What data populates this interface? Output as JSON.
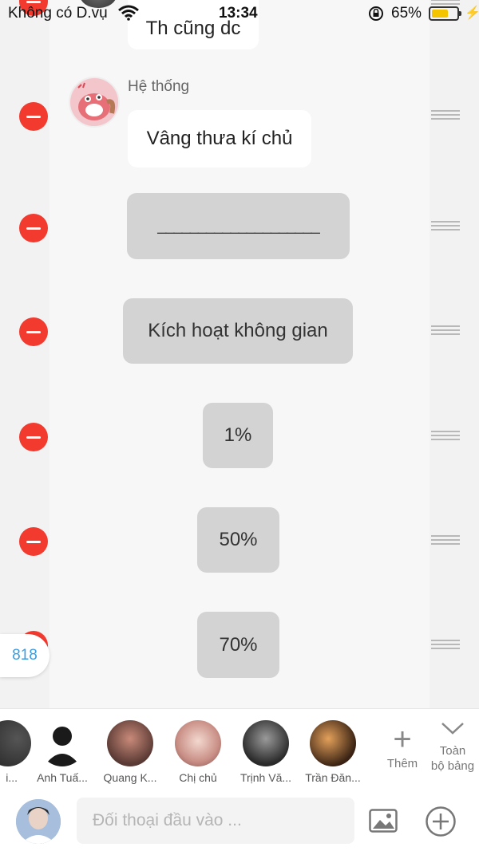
{
  "status_bar": {
    "carrier": "Không có D.vụ",
    "time": "13:34",
    "battery_percent": "65%",
    "battery_level": 0.65,
    "battery_color": "#f5c400"
  },
  "chat": {
    "top_bubble_text": "Th cũng dc",
    "system_sender_name": "Hệ thống",
    "system_message": "Vâng thưa kí chủ",
    "gray_bubbles": [
      "____________________",
      "Kích hoạt không gian",
      "1%",
      "50%",
      "70%"
    ],
    "unread_count": "818",
    "delete_color": "#f23a2f"
  },
  "contacts": {
    "items": [
      {
        "name": "i..."
      },
      {
        "name": "Anh Tuấ..."
      },
      {
        "name": "Quang K..."
      },
      {
        "name": "Chị chủ"
      },
      {
        "name": "Trịnh Vă..."
      },
      {
        "name": "Trần Đăn..."
      }
    ],
    "more_label": "Thêm",
    "all_label_line1": "Toàn",
    "all_label_line2": "bộ bảng"
  },
  "input_bar": {
    "placeholder": "Đối thoại đầu vào ..."
  }
}
